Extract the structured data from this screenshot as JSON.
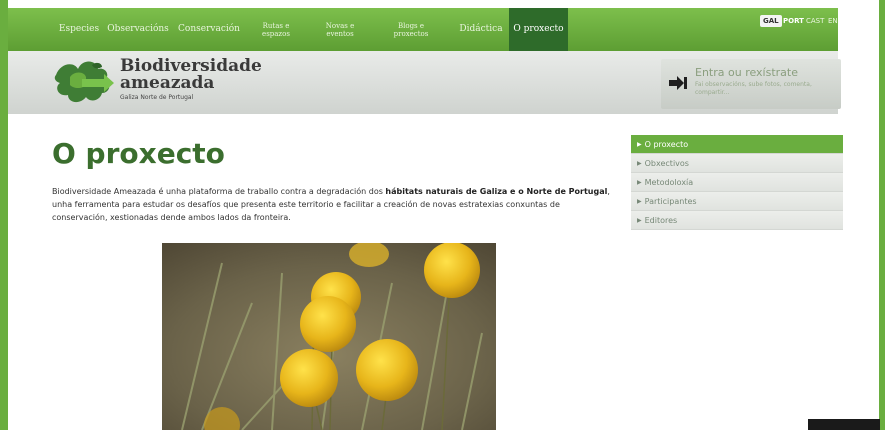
{
  "nav": {
    "items": [
      {
        "label": "Especies"
      },
      {
        "label": "Observacións"
      },
      {
        "label": "Conservación"
      },
      {
        "label": "Rutas e espazos"
      },
      {
        "label": "Novas e eventos"
      },
      {
        "label": "Blogs e proxectos"
      },
      {
        "label": "Didáctica"
      },
      {
        "label": "O proxecto"
      }
    ],
    "active_index": 7,
    "languages": [
      "GAL",
      "PORT",
      "CAST",
      "EN"
    ],
    "active_language": "GAL"
  },
  "brand": {
    "line1": "Biodiversidade",
    "line2": "ameazada",
    "line3": "Galiza Norte de Portugal"
  },
  "login": {
    "title": "Entra ou rexístrate",
    "subtitle": "Fai observacións, sube fotos, comenta, compartir..."
  },
  "main": {
    "title": "O proxecto",
    "intro_1": "Biodiversidade Ameazada é unha plataforma de traballo contra a degradación dos ",
    "intro_bold_1": "hábitats naturais de Galiza e o Norte de Portugal",
    "intro_2": ", unha ferramenta para estudar os desafíos que presenta este territorio e facilitar a creación de novas estratexias conxuntas de conservación, xestionadas dende ambos lados da fronteira."
  },
  "sidebar": {
    "items": [
      {
        "label": "O proxecto"
      },
      {
        "label": "Obxectivos"
      },
      {
        "label": "Metodoloxía"
      },
      {
        "label": "Participantes"
      },
      {
        "label": "Editores"
      }
    ],
    "active_index": 0
  },
  "colors": {
    "nav_green": "#6aae3f",
    "nav_active": "#2e6b2a",
    "title_green": "#3b6e2e"
  }
}
